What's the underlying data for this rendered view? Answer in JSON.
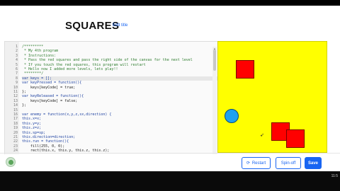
{
  "header": {
    "title": "SQUARES",
    "edit_title_label": "Edit title"
  },
  "editor": {
    "lines": [
      {
        "n": "1",
        "text": "/*********",
        "cls": "comment"
      },
      {
        "n": "2",
        "text": " * My 4th program",
        "cls": "comment"
      },
      {
        "n": "3",
        "text": " * Instructions:",
        "cls": "comment"
      },
      {
        "n": "4",
        "text": " * Pass the red squares and pass the right side of the canvas for the next level",
        "cls": "comment"
      },
      {
        "n": "5",
        "text": " * If you touch the red squares, this program will restart",
        "cls": "comment"
      },
      {
        "n": "6",
        "text": " * Hello now I added more levels, lets play!!",
        "cls": "comment"
      },
      {
        "n": "7",
        "text": " ********/",
        "cls": "comment"
      },
      {
        "n": "8",
        "text": "var keys = [];",
        "cls": "kw"
      },
      {
        "n": "9",
        "text": "var keyPressed = function(){",
        "cls": "kw"
      },
      {
        "n": "10",
        "text": "    keys[keyCode] = true;",
        "cls": ""
      },
      {
        "n": "11",
        "text": "};",
        "cls": ""
      },
      {
        "n": "12",
        "text": "var keyReleased = function(){",
        "cls": "kw"
      },
      {
        "n": "13",
        "text": "    keys[keyCode] = false;",
        "cls": ""
      },
      {
        "n": "14",
        "text": "};",
        "cls": ""
      },
      {
        "n": "15",
        "text": "",
        "cls": ""
      },
      {
        "n": "16",
        "text": "var enemy = function(x,y,z,sx,direction) {",
        "cls": "kw"
      },
      {
        "n": "17",
        "text": "this.x=x;",
        "cls": "kw"
      },
      {
        "n": "18",
        "text": "this.y=y;",
        "cls": "kw"
      },
      {
        "n": "19",
        "text": "this.z=z;",
        "cls": "kw"
      },
      {
        "n": "20",
        "text": "this.sp=sp;",
        "cls": "kw"
      },
      {
        "n": "21",
        "text": "this.direction=direction;",
        "cls": "kw"
      },
      {
        "n": "22",
        "text": "this.run = function(){",
        "cls": "kw"
      },
      {
        "n": "23",
        "text": "    fill(255, 0, 0);",
        "cls": ""
      },
      {
        "n": "24",
        "text": "    rect(this.x, this.y, this.z, this.z);",
        "cls": ""
      }
    ]
  },
  "canvas": {
    "background": "#ffff00",
    "square_color": "#ff0000",
    "ball_color": "#1fa1f0"
  },
  "actions": {
    "restart_label": "Restart",
    "spinoff_label": "Spin-off",
    "save_label": "Save"
  },
  "colors": {
    "accent": "#1865f2"
  },
  "taskbar": {
    "clock": "11:5"
  }
}
